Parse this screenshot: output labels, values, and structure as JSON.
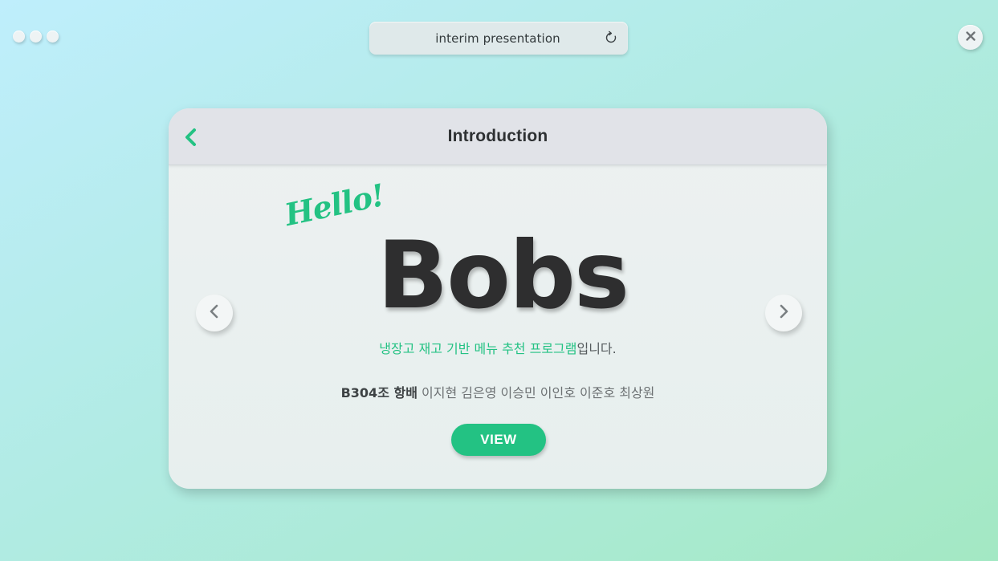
{
  "window": {
    "controls": [
      "window-dot",
      "window-dot",
      "window-dot"
    ],
    "close_icon": "close-icon"
  },
  "addressbar": {
    "text": "interim presentation",
    "icon": "reload-icon"
  },
  "card": {
    "title": "Introduction",
    "back_icon": "chevron-left-icon",
    "hello": "Hello!",
    "brand": "Bobs",
    "subtitle_accent": "냉장고 재고 기반 메뉴 추천 프로그램",
    "subtitle_rest": "입니다.",
    "team_label": "B304조 항배",
    "members": "이지현 김은영 이승민 이인호 이준호 최상원",
    "view_label": "VIEW"
  },
  "carousel": {
    "prev_icon": "chevron-left-icon",
    "next_icon": "chevron-right-icon"
  },
  "colors": {
    "accent": "#23c283",
    "text_dark": "#2e2e2f",
    "card_bg": "#edf1f1",
    "header_bg": "#e1e3e8"
  }
}
